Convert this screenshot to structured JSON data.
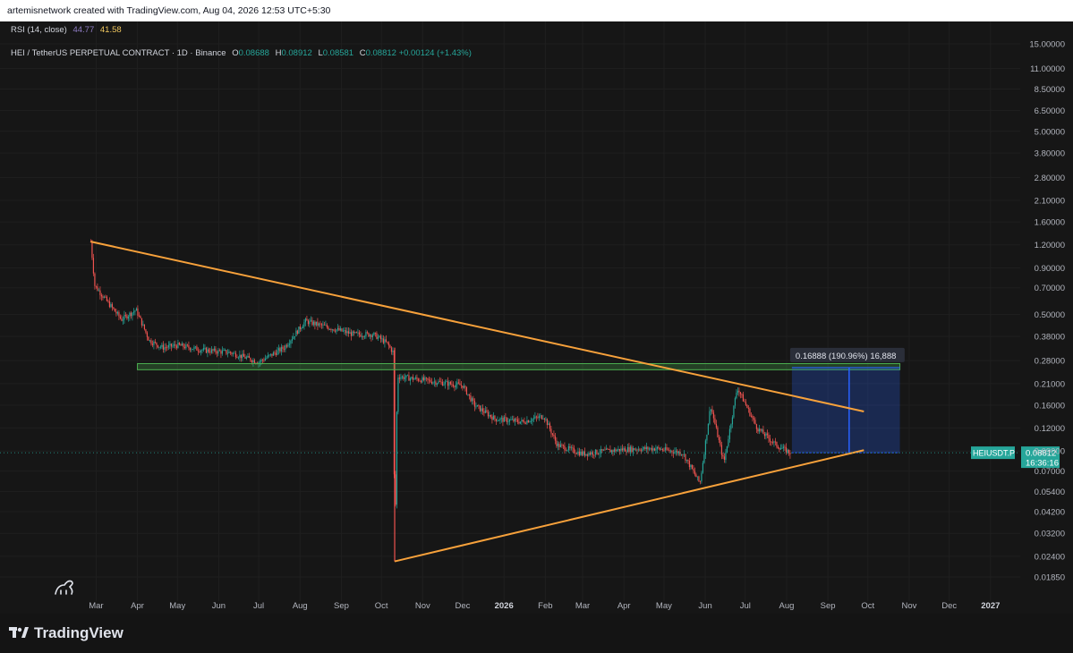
{
  "header": {
    "attribution": "artemisnetwork created with TradingView.com, Aug 04, 2026 12:53 UTC+5:30"
  },
  "indicator": {
    "label": "RSI (14, close)",
    "value1": "44.77",
    "value2": "41.58"
  },
  "symbol": {
    "title": "HEI / TetherUS PERPETUAL CONTRACT · 1D · Binance",
    "open_label": "O",
    "open": "0.08688",
    "high_label": "H",
    "high": "0.08912",
    "low_label": "L",
    "low": "0.08581",
    "close_label": "C",
    "close": "0.08812",
    "change": "+0.00124 (+1.43%)"
  },
  "price_tag": {
    "ticker": "HEIUSDT.P",
    "price": "0.08812",
    "countdown": "16:36:16"
  },
  "measure_label": "0.16888 (190.96%) 16,888",
  "branding": {
    "name": "TradingView"
  },
  "colors": {
    "up": "#26a69a",
    "down": "#ef5350",
    "trendline": "#f7a13b",
    "zone": "#4caf50",
    "measure": "#2962ff"
  },
  "chart_data": {
    "type": "line",
    "title": "HEI / TetherUS PERPETUAL CONTRACT · 1D · Binance",
    "y_scale": "log",
    "y_ticks": [
      "15.00000",
      "11.00000",
      "8.50000",
      "6.50000",
      "5.00000",
      "3.80000",
      "2.80000",
      "2.10000",
      "1.60000",
      "1.20000",
      "0.90000",
      "0.70000",
      "0.50000",
      "0.38000",
      "0.28000",
      "0.21000",
      "0.16000",
      "0.12000",
      "0.09000",
      "0.07000",
      "0.05400",
      "0.04200",
      "0.03200",
      "0.02400",
      "0.01850"
    ],
    "x_ticks": [
      "Mar",
      "Apr",
      "May",
      "Jun",
      "Jul",
      "Aug",
      "Sep",
      "Oct",
      "Nov",
      "Dec",
      "2026",
      "Feb",
      "Mar",
      "Apr",
      "May",
      "Jun",
      "Jul",
      "Aug",
      "Sep",
      "Oct",
      "Nov",
      "Dec",
      "2027"
    ],
    "series": [
      {
        "values": [
          [
            "Feb 25 2025",
            1.25
          ],
          [
            "Feb 28 2025",
            0.72
          ],
          [
            "Mar 10 2025",
            0.58
          ],
          [
            "Mar 20 2025",
            0.47
          ],
          [
            "Mar 31 2025",
            0.53
          ],
          [
            "Apr 10 2025",
            0.36
          ],
          [
            "Apr 20 2025",
            0.33
          ],
          [
            "May 1 2025",
            0.34
          ],
          [
            "May 20 2025",
            0.32
          ],
          [
            "Jun 10 2025",
            0.31
          ],
          [
            "Jul 1 2025",
            0.275
          ],
          [
            "Jul 20 2025",
            0.33
          ],
          [
            "Aug 5 2025",
            0.46
          ],
          [
            "Aug 20 2025",
            0.43
          ],
          [
            "Sep 10 2025",
            0.39
          ],
          [
            "Sep 25 2025",
            0.39
          ],
          [
            "Oct 5 2025",
            0.35
          ],
          [
            "Oct 10 2025",
            0.31
          ],
          [
            "Oct 11 2025",
            0.023
          ],
          [
            "Oct 13 2025",
            0.23
          ],
          [
            "Nov 1 2025",
            0.22
          ],
          [
            "Nov 20 2025",
            0.21
          ],
          [
            "Dec 1 2025",
            0.205
          ],
          [
            "Dec 10 2025",
            0.16
          ],
          [
            "Dec 25 2025",
            0.135
          ],
          [
            "Jan 15 2026",
            0.13
          ],
          [
            "Jan 31 2026",
            0.14
          ],
          [
            "Feb 10 2026",
            0.097
          ],
          [
            "Mar 1 2026",
            0.087
          ],
          [
            "Apr 1 2026",
            0.092
          ],
          [
            "Apr 25 2026",
            0.093
          ],
          [
            "May 15 2026",
            0.088
          ],
          [
            "May 28 2026",
            0.06
          ],
          [
            "Jun 5 2026",
            0.16
          ],
          [
            "Jun 15 2026",
            0.078
          ],
          [
            "Jun 25 2026",
            0.2
          ],
          [
            "Jul 10 2026",
            0.12
          ],
          [
            "Jul 25 2026",
            0.096
          ],
          [
            "Aug 4 2026",
            0.08812
          ]
        ]
      }
    ],
    "annotations": {
      "upper_trendline": [
        [
          "Feb 25 2025",
          1.25
        ],
        [
          "Sep 28 2026",
          0.148
        ]
      ],
      "lower_trendline": [
        [
          "Oct 11 2025",
          0.0225
        ],
        [
          "Sep 28 2026",
          0.091
        ]
      ],
      "horizontal_zone": {
        "from": "Apr 1 2025",
        "to": "Oct 25 2026",
        "low": 0.25,
        "high": 0.27
      },
      "measure_box": {
        "from": "Aug 5 2026",
        "to": "Oct 25 2026",
        "low": 0.08812,
        "high": 0.257
      }
    }
  }
}
